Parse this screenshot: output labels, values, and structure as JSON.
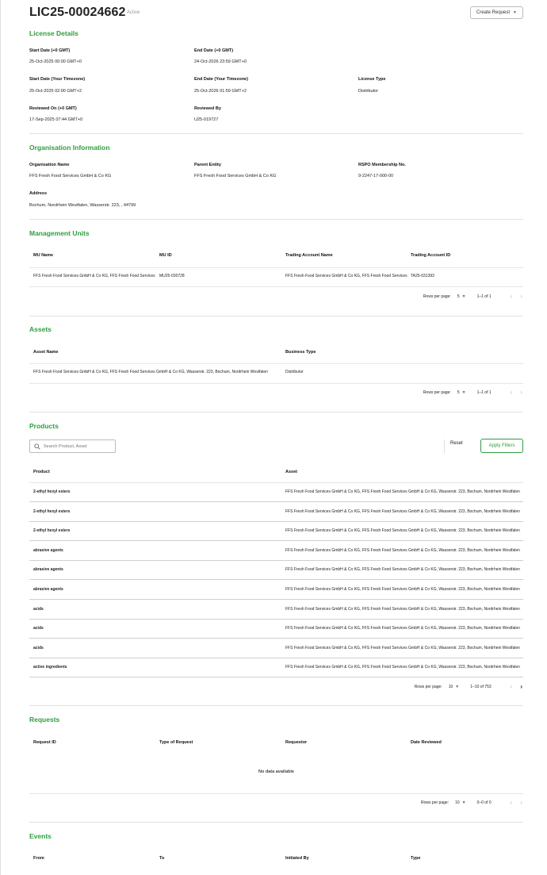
{
  "header": {
    "license_id": "LIC25-00024662",
    "status": "Active",
    "create_request_label": "Create Request"
  },
  "license_details": {
    "title": "License Details",
    "fields": [
      {
        "label": "Start Date (+0 GMT)",
        "value": "25-Oct-2025 00:00 GMT+0"
      },
      {
        "label": "End Date (+0 GMT)",
        "value": "24-Oct-2026 23:59 GMT+0"
      },
      {
        "label": "Start Date (Your Timezone)",
        "value": "25-Oct-2025 02:00 GMT+2"
      },
      {
        "label": "End Date (Your Timezone)",
        "value": "25-Oct-2026 01:59 GMT+2"
      },
      {
        "label": "License Type",
        "value": "Distributor"
      },
      {
        "label": "Reviewed On (+0 GMT)",
        "value": "17-Sep-2025 07:44 GMT+0"
      },
      {
        "label": "Reviewed By",
        "value": "U25-019727"
      }
    ]
  },
  "organisation": {
    "title": "Organisation Information",
    "fields": [
      {
        "label": "Organisation Name",
        "value": "FFS Fresh Food Services GmbH & Co KG"
      },
      {
        "label": "Parent Entity",
        "value": "FFS Fresh Food Services GmbH & Co KG"
      },
      {
        "label": "RSPO Membership No.",
        "value": "9-2247-17-000-00"
      },
      {
        "label": "Address",
        "value": "Bochum, Nordrhein Westfalen, Wasserstr. 223, , 44799"
      }
    ]
  },
  "management_units": {
    "title": "Management Units",
    "columns": [
      "MU Name",
      "MU ID",
      "Trading Account Name",
      "Trading Account ID"
    ],
    "rows": [
      [
        "FFS Fresh Food Services GmbH & Co KG, FFS Fresh Food Services GmbH & Co KG",
        "MU25-030728",
        "FFS Fresh Food Services GmbH & Co KG, FFS Fresh Food Services",
        "TA25-031393"
      ]
    ],
    "pagination": {
      "rows_per_page_label": "Rows per page:",
      "rows_per_page": "5",
      "range": "1–1 of 1"
    }
  },
  "assets": {
    "title": "Assets",
    "columns": [
      "Asset Name",
      "Business Type"
    ],
    "rows": [
      [
        "FFS Fresh Food Services GmbH & Co KG, FFS Fresh Food Services GmbH & Co KG, Wasserstr. 223, Bochum, Nordrhein Westfalen",
        "Distributor"
      ]
    ],
    "pagination": {
      "rows_per_page_label": "Rows per page:",
      "rows_per_page": "5",
      "range": "1–1 of 1"
    }
  },
  "products": {
    "title": "Products",
    "search_placeholder": "Search Product, Asset",
    "reset_label": "Reset",
    "apply_label": "Apply Filters",
    "columns": [
      "Product",
      "Asset"
    ],
    "asset_value": "FFS Fresh Food Services GmbH & Co KG, FFS Fresh Food Services GmbH & Co KG, Wasserstr. 223, Bochum, Nordrhein Westfalen",
    "rows": [
      "2-ethyl hexyl esters",
      "2-ethyl hexyl esters",
      "2-ethyl hexyl esters",
      "abrasive agents",
      "abrasive agents",
      "abrasive agents",
      "acids",
      "acids",
      "acids",
      "active ingredients"
    ],
    "pagination": {
      "rows_per_page_label": "Rows per page:",
      "rows_per_page": "10",
      "range": "1–10 of 753"
    }
  },
  "requests": {
    "title": "Requests",
    "columns": [
      "Request ID",
      "Type of Request",
      "Requestor",
      "Date Reviewed"
    ],
    "empty_text": "No data available",
    "pagination": {
      "rows_per_page_label": "Rows per page:",
      "rows_per_page": "10",
      "range": "0–0 of 0"
    }
  },
  "events": {
    "title": "Events",
    "columns": [
      "From",
      "To",
      "Initiated By",
      "Type"
    ]
  },
  "icons": {
    "dropdown": "chevron-down-icon",
    "search": "search-icon",
    "prev": "chevron-left-icon",
    "next": "chevron-right-icon"
  },
  "colors": {
    "accent": "#2e9e3e"
  }
}
